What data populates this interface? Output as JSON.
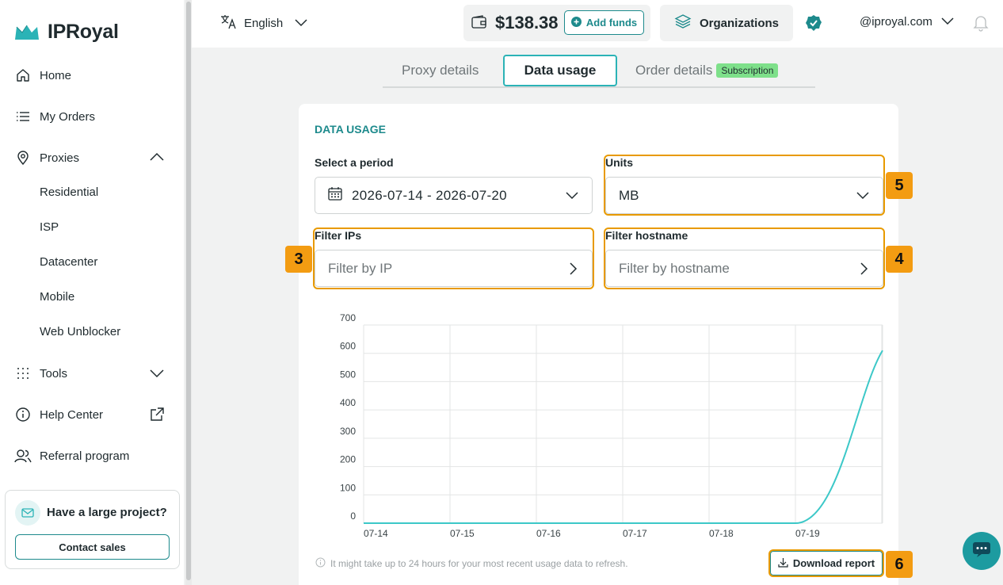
{
  "brand": {
    "name": "IPRoyal",
    "accent": "#1d8a8c",
    "teal_light": "#2bb3b6"
  },
  "sidebar": {
    "items": [
      {
        "label": "Home",
        "icon": "home-icon"
      },
      {
        "label": "My Orders",
        "icon": "list-icon"
      },
      {
        "label": "Proxies",
        "icon": "location-pin-icon",
        "expanded": true
      },
      {
        "label": "Tools",
        "icon": "grid-dots-icon",
        "expanded": false
      },
      {
        "label": "Help Center",
        "icon": "info-circle-icon"
      },
      {
        "label": "Referral program",
        "icon": "users-icon"
      }
    ],
    "proxies_sub": [
      "Residential",
      "ISP",
      "Datacenter",
      "Mobile",
      "Web Unblocker"
    ],
    "promo": {
      "title": "Have a large project?",
      "button": "Contact sales"
    }
  },
  "topbar": {
    "language": "English",
    "balance": "$138.38",
    "add_funds": "Add funds",
    "organizations": "Organizations",
    "account": "@iproyal.com"
  },
  "tabs": [
    {
      "label": "Proxy details",
      "active": false
    },
    {
      "label": "Data usage",
      "active": true
    },
    {
      "label": "Order details",
      "active": false,
      "badge": "Subscription"
    }
  ],
  "data_usage": {
    "title": "DATA USAGE",
    "period_label": "Select a period",
    "period_value": "2026-07-14 - 2026-07-20",
    "units_label": "Units",
    "units_value": "MB",
    "filter_ips_label": "Filter IPs",
    "filter_ips_placeholder": "Filter by IP",
    "filter_host_label": "Filter hostname",
    "filter_host_placeholder": "Filter by hostname",
    "note": "It might take up to 24 hours for your most recent usage data to refresh.",
    "download": "Download report"
  },
  "markers": [
    "3",
    "4",
    "5",
    "6"
  ],
  "chart_data": {
    "type": "line",
    "x_tick_labels": [
      "07-14",
      "07-15",
      "07-16",
      "07-17",
      "07-18",
      "07-19"
    ],
    "y_tick_labels": [
      "0",
      "100",
      "200",
      "300",
      "400",
      "500",
      "600",
      "700"
    ],
    "ylim": [
      0,
      700
    ],
    "grid": true,
    "series": [
      {
        "color": "#3cc8c8",
        "points": [
          {
            "x": "07-14",
            "y": 0
          },
          {
            "x": "07-15",
            "y": 0
          },
          {
            "x": "07-16",
            "y": 0
          },
          {
            "x": "07-17",
            "y": 0
          },
          {
            "x": "07-18",
            "y": 0
          },
          {
            "x": "07-19",
            "y": 0
          },
          {
            "x": "07-20",
            "y": 610
          }
        ]
      }
    ]
  }
}
